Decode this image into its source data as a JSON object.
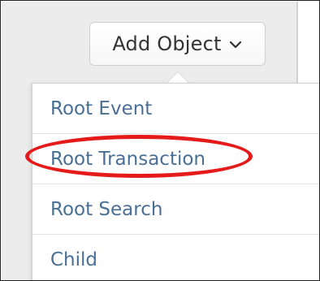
{
  "toolbar": {
    "add_object_label": "Add Object",
    "chevron_icon": "chevron-down-icon"
  },
  "menu": {
    "items": [
      {
        "label": "Root Event"
      },
      {
        "label": "Root Transaction",
        "highlighted": true
      },
      {
        "label": "Root Search"
      },
      {
        "label": "Child"
      }
    ]
  },
  "colors": {
    "menu_text": "#4a6f94",
    "highlight_ring": "#e51b1b",
    "panel_background": "#ececec"
  }
}
